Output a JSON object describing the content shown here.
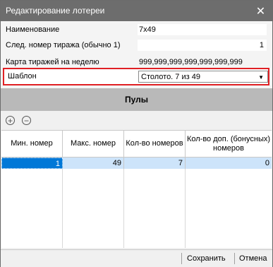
{
  "window": {
    "title": "Редактирование лотереи",
    "close_icon": "close-icon"
  },
  "form": {
    "name_label": "Наименование",
    "name_value": "7x49",
    "next_draw_label": "След. номер тиража (обычно 1)",
    "next_draw_value": "1",
    "week_map_label": "Карта тиражей на неделю",
    "week_map_value": "999,999,999,999,999,999,999",
    "template_label": "Шаблон",
    "template_value": "Столото. 7 из 49"
  },
  "section": {
    "title": "Пулы"
  },
  "toolbar": {
    "add_icon": "plus-circle-icon",
    "remove_icon": "minus-circle-icon"
  },
  "grid": {
    "columns": [
      "Мин. номер",
      "Макс. номер",
      "Кол-во номеров",
      "Кол-во доп. (бонусных) номеров"
    ],
    "rows": [
      [
        "1",
        "49",
        "7",
        "0"
      ]
    ]
  },
  "footer": {
    "save_label": "Сохранить",
    "cancel_label": "Отмена"
  }
}
